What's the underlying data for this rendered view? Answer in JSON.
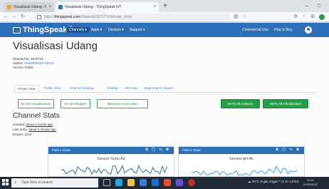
{
  "browser": {
    "tabs": [
      {
        "title": "Visualisasi Udang - Firebase co",
        "close": "×",
        "active": false
      },
      {
        "title": "Visualisasi Udang - ThingSpeak IoT",
        "close": "×",
        "active": true
      }
    ],
    "new_tab": "+",
    "window_controls": [
      "–",
      "□"
    ],
    "nav": {
      "back": "←",
      "forward": "→",
      "reload": "↻"
    },
    "url_prefix": "https://",
    "url_host": "thingspeak.com",
    "url_path": "/channels/1572713/private_show"
  },
  "header": {
    "logo": "ThingSpeak",
    "tm": "™",
    "menu": [
      "Channels ▾",
      "Apps ▾",
      "Devices ▾",
      "Support ▾"
    ],
    "right_links": [
      "Commercial Use",
      "How to Buy"
    ]
  },
  "channel": {
    "title": "Visualisasi Udang",
    "id_line": "Channel ID: 1572713",
    "author_label": "Author: ",
    "author_value": "mwa0000034738224",
    "access_line": "Access: Public"
  },
  "tabs": [
    "Private View",
    "Public View",
    "Channel Settings",
    "Sharing",
    "API Keys",
    "Data Import / Export"
  ],
  "buttons": {
    "add_visualizations": "⊕ Add Visualizations",
    "add_widgets": "⊕ Add Widgets",
    "export": "⊠ Export recent data",
    "matlab_analysis": "MATLAB Analysis",
    "matlab_visualization": "MATLAB Visualization"
  },
  "stats": {
    "title": "Channel Stats",
    "created_label": "Created: ",
    "created_value": "about a month ago",
    "last_entry_label": "Last entry: ",
    "last_entry_value": "about a minute ago",
    "entries_line": "Entries: 1124"
  },
  "panels": [
    {
      "title": "Field 1 Chart",
      "icons": "⧉ ◯ ✎ ✖",
      "chart_title": "Sensor Suhu Air",
      "color": "#2f6f8f"
    },
    {
      "title": "Field 2 Chart",
      "icons": "⧉ ◯ ✎ ✖",
      "chart_title": "Sensor pH Air",
      "color": "#3d9be9"
    }
  ],
  "taskbar": {
    "search_placeholder": "Type here to search",
    "tray": "☁ 29°C Hujan ringan ^ ⊡ ✉ ◁ ENG",
    "time": "19:11",
    "date": "07/02/2022"
  },
  "colors": {
    "brand": "#2c6fb7",
    "green": "#23a047",
    "link": "#3a86d4"
  }
}
